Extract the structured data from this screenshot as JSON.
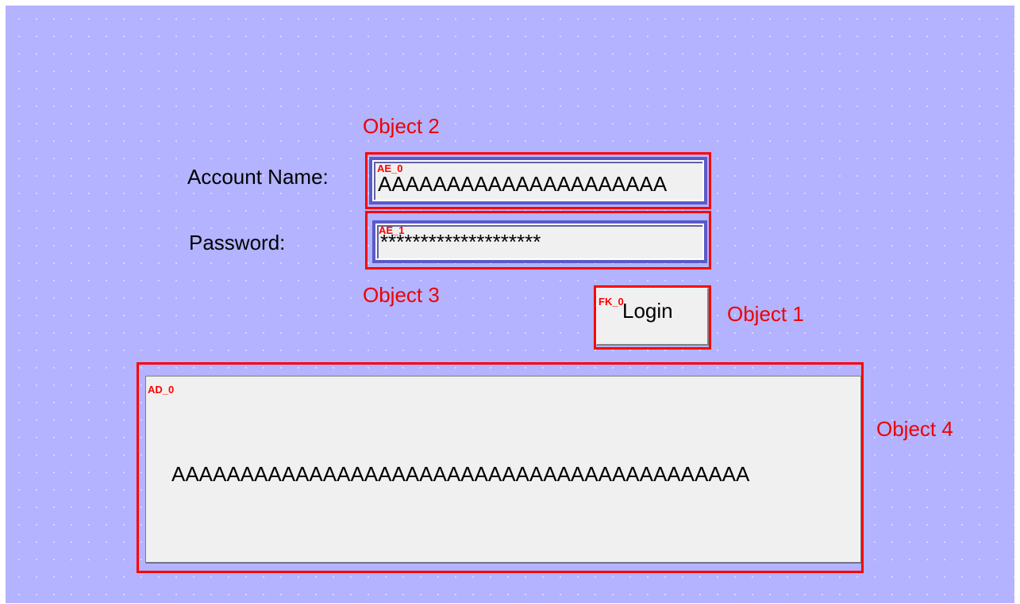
{
  "form": {
    "account_label": "Account Name:",
    "password_label": "Password:",
    "account_value": "AAAAAAAAAAAAAAAAAAAAA",
    "password_value": "********************",
    "login_label": "Login",
    "display_value": "AAAAAAAAAAAAAAAAAAAAAAAAAAAAAAAAAAAAAAAAAA"
  },
  "tags": {
    "account_field": "AE_0",
    "password_field": "AE_1",
    "login_button": "FK_0",
    "display": "AD_0"
  },
  "annotations": {
    "object1": "Object 1",
    "object2": "Object 2",
    "object3": "Object 3",
    "object4": "Object 4"
  },
  "colors": {
    "background": "#b3b3ff",
    "highlight": "#ff0000",
    "field_border": "#5a5ac8"
  }
}
